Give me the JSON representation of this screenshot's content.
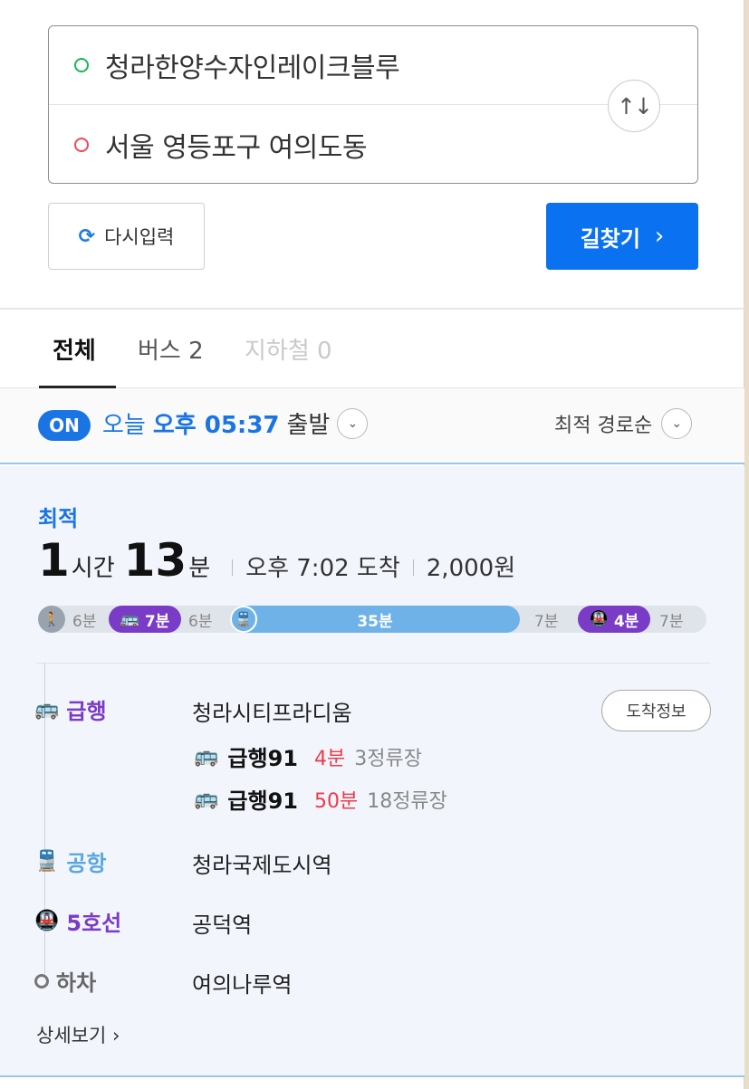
{
  "route": {
    "start": "청라한양수자인레이크블루",
    "end": "서울 영등포구 여의도동",
    "swap_icon": "↑↓"
  },
  "actions": {
    "reset_label": "다시입력",
    "reset_icon": "⟳",
    "search_label": "길찾기",
    "search_chevron": "›"
  },
  "tabs": [
    {
      "label": "전체"
    },
    {
      "label": "버스 2"
    },
    {
      "label": "지하철 0"
    }
  ],
  "departure": {
    "badge": "ON",
    "day": "오늘",
    "time": "오후 05:37",
    "suffix": "출발",
    "sort_label": "최적 경로순",
    "chevron": "⌄"
  },
  "result": {
    "tag": "최적",
    "hours": "1",
    "hours_unit": "시간",
    "minutes": "13",
    "minutes_unit": "분",
    "arrival": "오후 7:02 도착",
    "fare": "2,000원",
    "bar": {
      "walk1": "6분",
      "bus1": "7분",
      "walk2": "6분",
      "rail": "35분",
      "walk3": "7분",
      "subway": "4분",
      "walk4": "7분"
    },
    "steps": [
      {
        "mode": "급행",
        "station": "청라시티프라디움"
      },
      {
        "mode": "공항",
        "station": "청라국제도시역"
      },
      {
        "mode": "5호선",
        "station": "공덕역"
      },
      {
        "mode": "하차",
        "station": "여의나루역"
      }
    ],
    "arrival_info_label": "도착정보",
    "buses": [
      {
        "name": "급행91",
        "time": "4분",
        "stops": "3정류장"
      },
      {
        "name": "급행91",
        "time": "50분",
        "stops": "18정류장"
      }
    ],
    "details_label": "상세보기 ›"
  },
  "colors": {
    "primary": "#0a72f0",
    "bus": "#7a3bc7",
    "rail": "#6eb2e8",
    "walk": "#9aa3ad",
    "alert": "#ef3a4a"
  }
}
